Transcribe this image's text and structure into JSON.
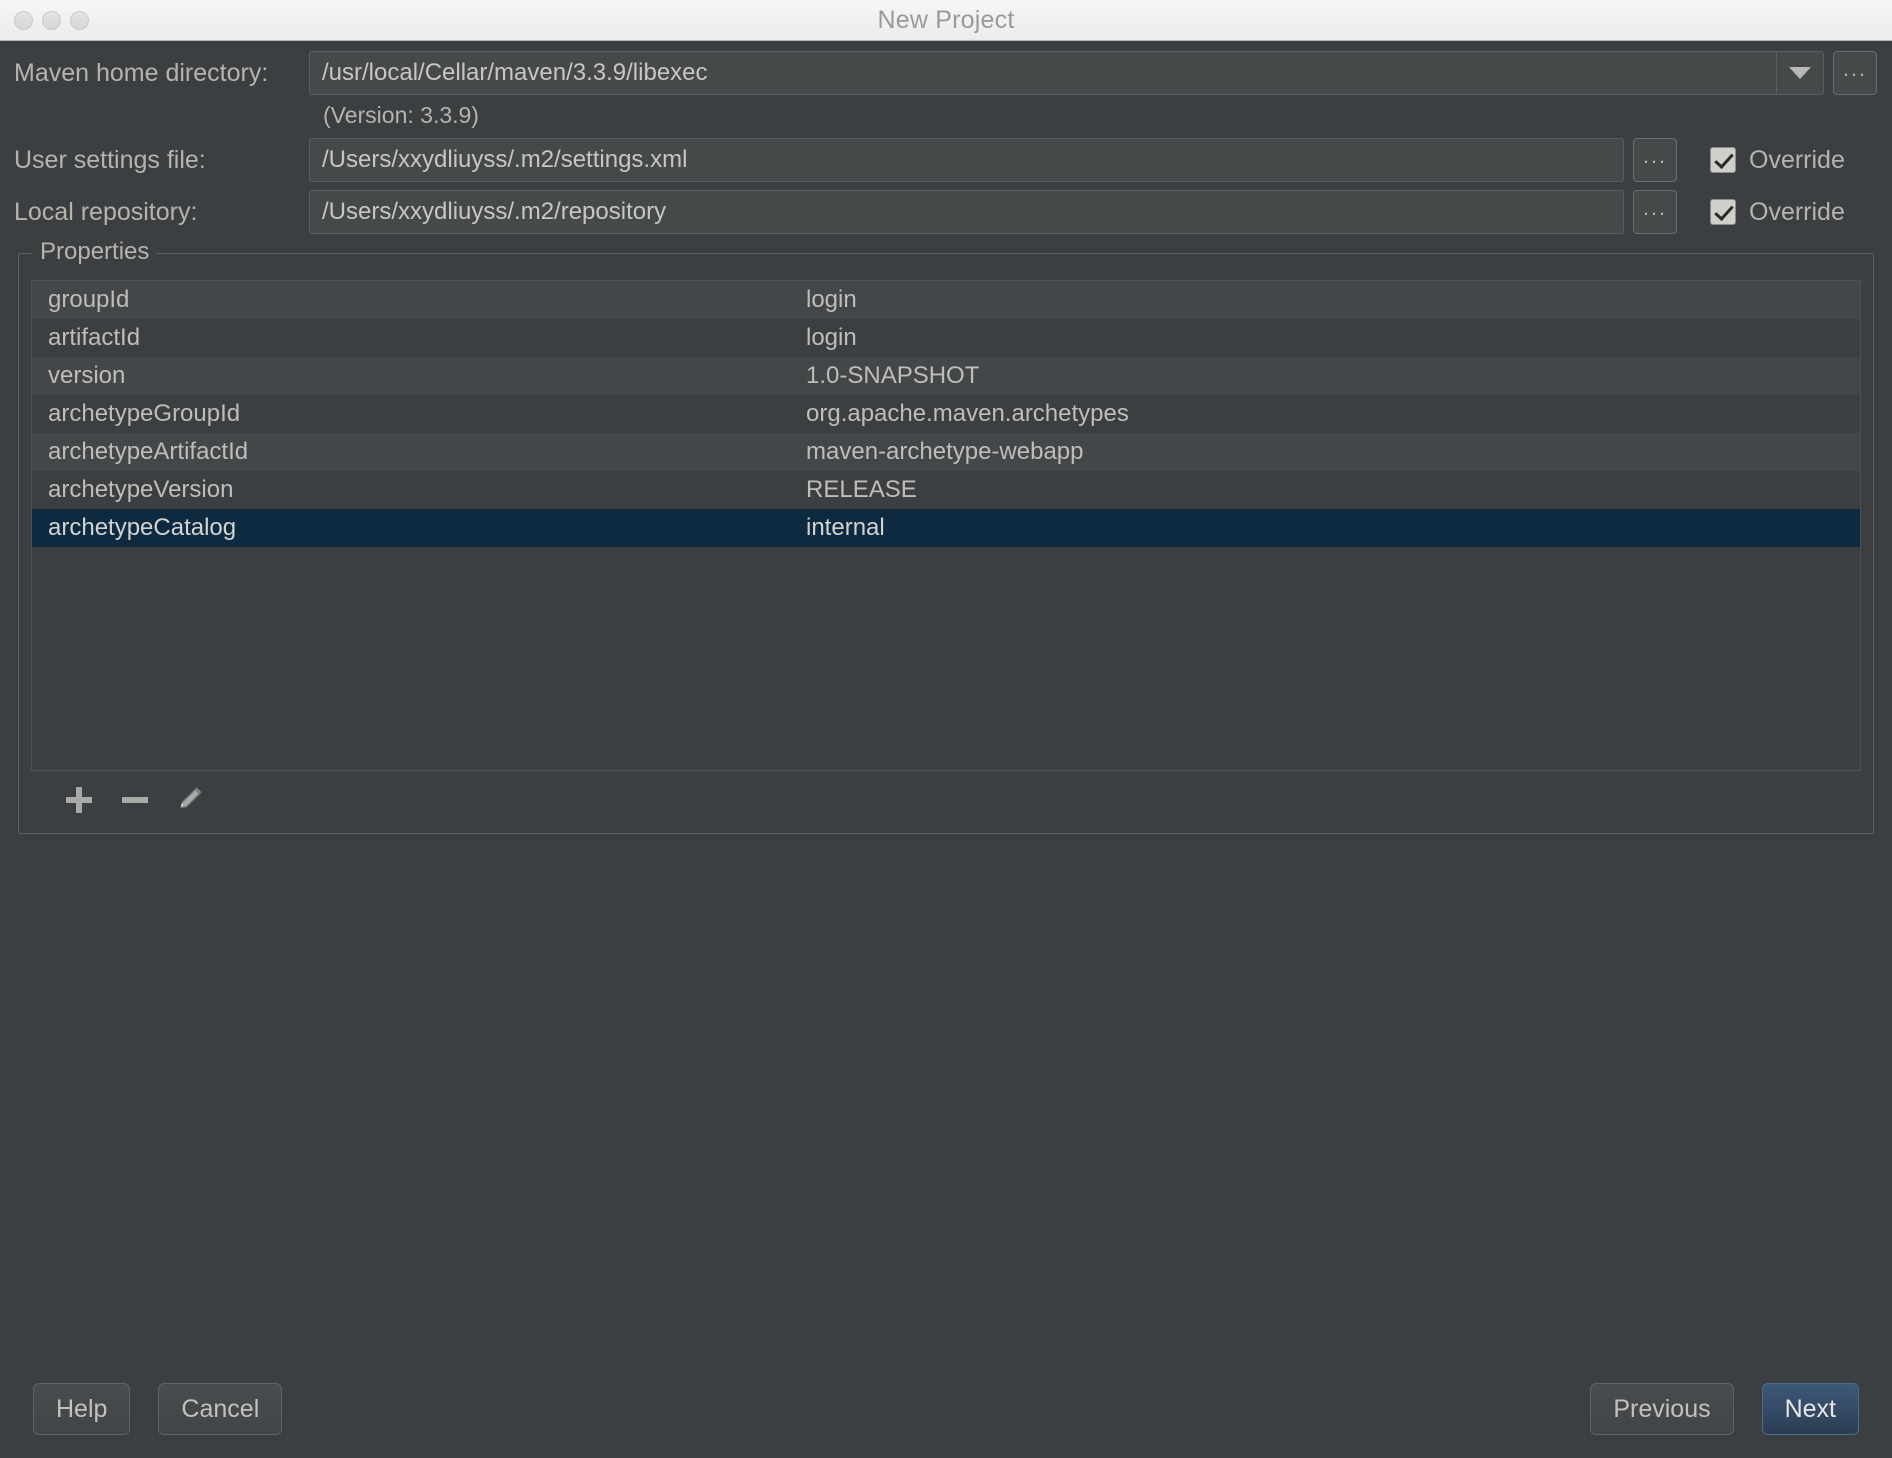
{
  "window": {
    "title": "New Project",
    "traffic_lights": [
      "close-button",
      "minimize-button",
      "zoom-button"
    ]
  },
  "form": {
    "maven_home": {
      "label": "Maven home directory:",
      "value": "/usr/local/Cellar/maven/3.3.9/libexec",
      "placeholder": "",
      "dropdown_icon": "chevron-down-icon",
      "browse_label": "..."
    },
    "version_note": "(Version: 3.3.9)",
    "user_settings": {
      "label": "User settings file:",
      "value": "/Users/xxydliuyss/.m2/settings.xml",
      "placeholder": "",
      "browse_label": "...",
      "override_label": "Override",
      "override_checked": true
    },
    "local_repository": {
      "label": "Local repository:",
      "value": "/Users/xxydliuyss/.m2/repository",
      "placeholder": "",
      "browse_label": "...",
      "override_label": "Override",
      "override_checked": true
    }
  },
  "properties": {
    "group_title": "Properties",
    "rows": [
      {
        "key": "groupId",
        "value": "login"
      },
      {
        "key": "artifactId",
        "value": "login"
      },
      {
        "key": "version",
        "value": "1.0-SNAPSHOT"
      },
      {
        "key": "archetypeGroupId",
        "value": "org.apache.maven.archetypes"
      },
      {
        "key": "archetypeArtifactId",
        "value": "maven-archetype-webapp"
      },
      {
        "key": "archetypeVersion",
        "value": "RELEASE"
      },
      {
        "key": "archetypeCatalog",
        "value": "internal"
      }
    ],
    "selected_index": 6,
    "toolbar": {
      "add_icon": "plus-icon",
      "remove_icon": "minus-icon",
      "edit_icon": "pencil-icon"
    }
  },
  "footer": {
    "help_label": "Help",
    "cancel_label": "Cancel",
    "previous_label": "Previous",
    "next_label": "Next"
  },
  "colors": {
    "background": "#3c3f41",
    "row_alt": "#434749",
    "selection": "#0e2a40",
    "text": "#b6b3ad",
    "primary_button": "#3e5878"
  }
}
